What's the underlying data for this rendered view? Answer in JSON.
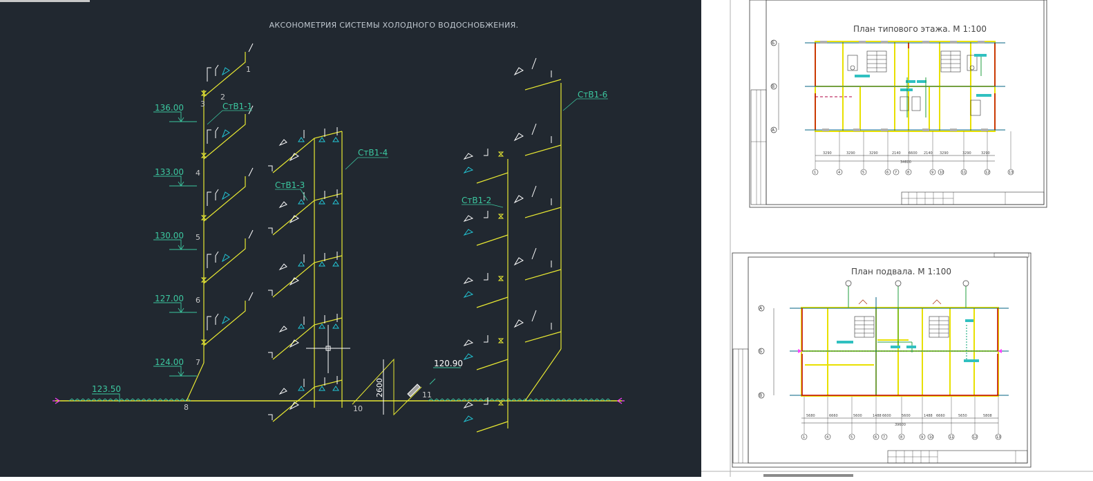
{
  "cad": {
    "title": "АКСОНОМЕТРИЯ СИСТЕМЫ ХОЛОДНОГО ВОДОСНОБЖЕНИЯ.",
    "elevations": [
      "136.00",
      "133.00",
      "130.00",
      "127.00",
      "124.00",
      "123.50",
      "120.90"
    ],
    "risers": [
      "СтВ1-1",
      "СтВ1-2",
      "СтВ1-3",
      "СтВ1-4",
      "СтВ1-6"
    ],
    "nodes": [
      "1",
      "2",
      "3",
      "4",
      "5",
      "6",
      "7",
      "8",
      "10",
      "11"
    ],
    "dimension": "2600",
    "colors": {
      "background": "#212830",
      "pipe": "#e8e832",
      "fixture": "#ffffff",
      "accent": "#22c8d8",
      "label": "#3cc8a0",
      "axis": "#ff40ff"
    }
  },
  "sheets": {
    "typical": {
      "title": "План типового этажа. М 1:100",
      "row_axes": [
        "Б",
        "В",
        "А"
      ],
      "col_axes": [
        "1",
        "4",
        "5",
        "6",
        "7",
        "8",
        "9",
        "10",
        "11",
        "12",
        "13"
      ]
    },
    "basement": {
      "title": "План подвала. М 1:100",
      "row_axes": [
        "А",
        "Б",
        "В"
      ],
      "col_axes": [
        "1",
        "4",
        "5",
        "6",
        "7",
        "8",
        "9",
        "10",
        "11",
        "12",
        "13"
      ]
    }
  }
}
